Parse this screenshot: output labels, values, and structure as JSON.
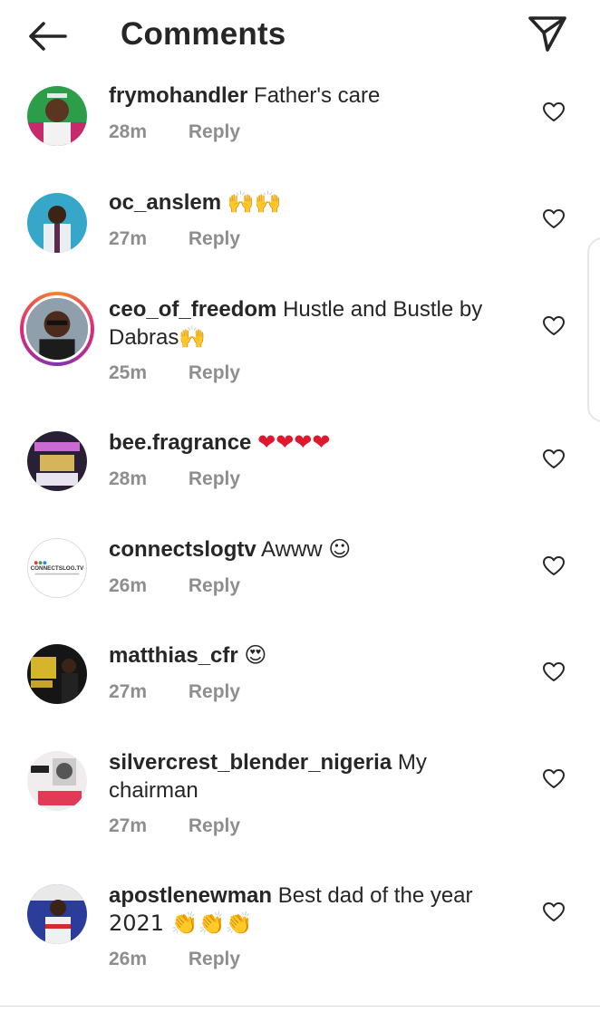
{
  "header": {
    "title": "Comments",
    "back_icon": "arrow-left-icon",
    "send_icon": "paper-plane-icon"
  },
  "colors": {
    "text": "#262626",
    "meta": "#8e8e8e",
    "heart": "#e0182d",
    "story_ring": [
      "#f58529",
      "#dd2a7b",
      "#8134af"
    ]
  },
  "comments": [
    {
      "username": "frymohandler",
      "text": "Father's care",
      "emoji": "",
      "text_line2": "",
      "time": "28m",
      "reply": "Reply"
    },
    {
      "username": "oc_anslem",
      "text": "",
      "emoji": "🙌🙌",
      "text_line2": "",
      "time": "27m",
      "reply": "Reply"
    },
    {
      "username": "ceo_of_freedom",
      "text": "Hustle and Bustle by",
      "emoji": "",
      "text_line2": "Dabras🙌",
      "time": "25m",
      "reply": "Reply"
    },
    {
      "username": "bee.fragrance",
      "text": "",
      "emoji": "❤❤❤❤",
      "text_line2": "",
      "time": "28m",
      "reply": "Reply"
    },
    {
      "username": "connectslogtv",
      "text": "Awww",
      "emoji": "☺",
      "text_line2": "",
      "time": "26m",
      "reply": "Reply"
    },
    {
      "username": "matthias_cfr",
      "text": "",
      "emoji": "😍",
      "text_line2": "",
      "time": "27m",
      "reply": "Reply"
    },
    {
      "username": "silvercrest_blender_nigeria",
      "text": "My",
      "emoji": "",
      "text_line2": "chairman",
      "time": "27m",
      "reply": "Reply"
    },
    {
      "username": "apostlenewman",
      "text": "Best dad of the year",
      "emoji": "",
      "text_line2": "2021 👏👏👏",
      "time": "26m",
      "reply": "Reply"
    }
  ],
  "avatar_logo_text": "CONNECTSLOG.TV"
}
